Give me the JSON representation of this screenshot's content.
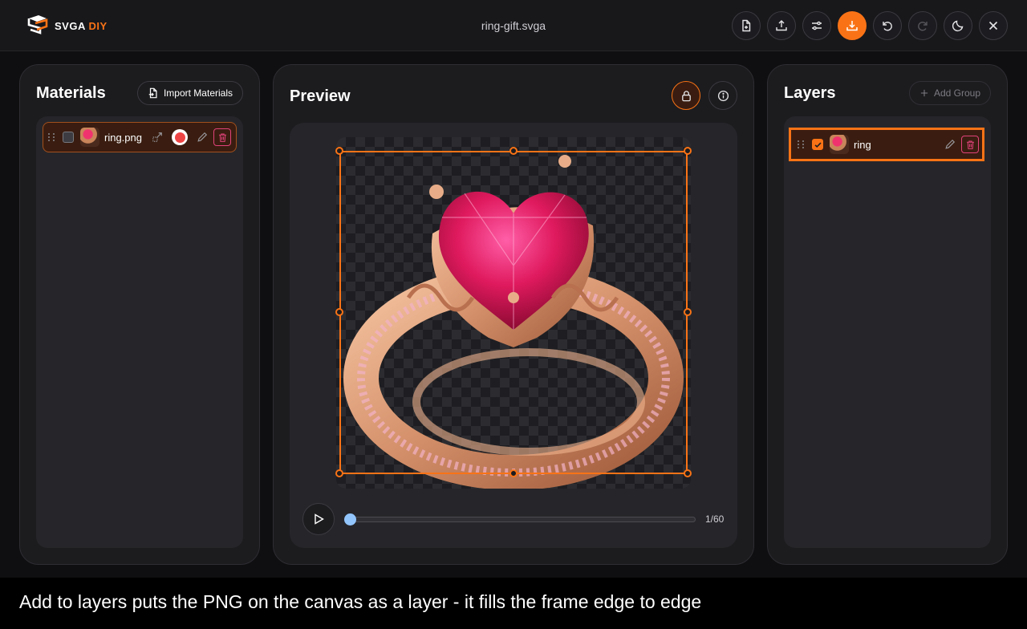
{
  "app": {
    "logo_prefix": "SVGA",
    "logo_suffix": "DIY",
    "filename": "ring-gift.svga"
  },
  "toolbar": {
    "buttons": [
      {
        "name": "new-file",
        "icon": "file-plus-icon"
      },
      {
        "name": "upload",
        "icon": "upload-icon"
      },
      {
        "name": "settings",
        "icon": "sliders-icon"
      },
      {
        "name": "download",
        "icon": "download-icon",
        "active": true
      },
      {
        "name": "undo",
        "icon": "undo-icon"
      },
      {
        "name": "redo",
        "icon": "redo-icon",
        "disabled": true
      },
      {
        "name": "theme",
        "icon": "moon-icon"
      },
      {
        "name": "close",
        "icon": "close-icon"
      }
    ]
  },
  "materials": {
    "title": "Materials",
    "import_label": "Import Materials",
    "items": [
      {
        "name": "ring.png",
        "checked": false,
        "selected": true
      }
    ]
  },
  "preview": {
    "title": "Preview",
    "current_frame": 1,
    "total_frames": 60,
    "frame_label": "1/60",
    "progress": 0.0
  },
  "layers": {
    "title": "Layers",
    "add_group_label": "Add Group",
    "items": [
      {
        "name": "ring",
        "checked": true,
        "selected": true
      }
    ]
  },
  "caption": "Add to layers puts the PNG on the canvas as a layer - it fills the frame edge to edge",
  "colors": {
    "accent": "#f97316",
    "danger": "#e0427a",
    "progress_knob": "#93c5fd"
  }
}
